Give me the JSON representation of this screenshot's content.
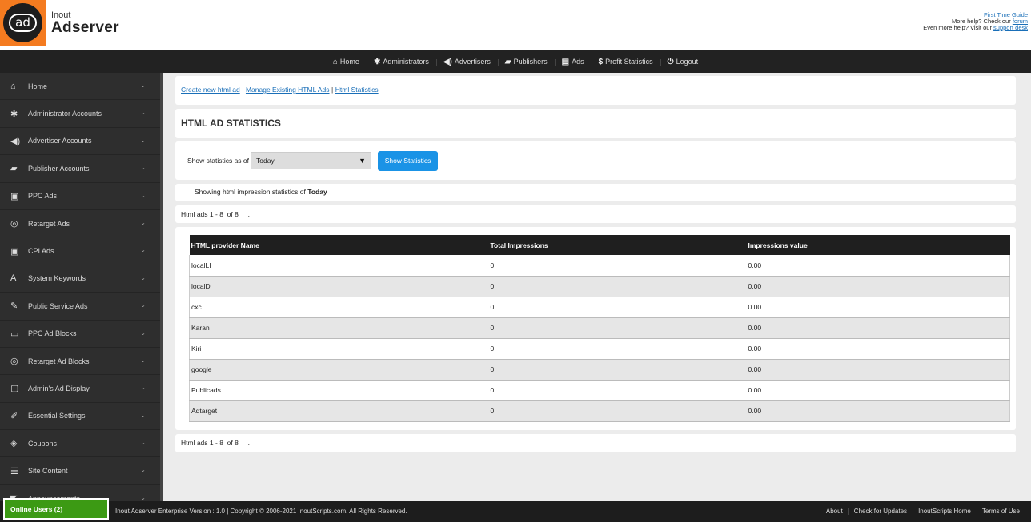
{
  "brand": {
    "small": "Inout",
    "big": "Adserver",
    "logo_text": "ad"
  },
  "help": {
    "first_time_guide": "First Time Guide",
    "more_help_prefix": "More help? Check our",
    "forum": "forum",
    "even_more_prefix": "Even more help? Visit our",
    "support_desk": "support desk"
  },
  "topnav": [
    {
      "label": "Home",
      "icon": "home-icon",
      "glyph": "⌂"
    },
    {
      "label": "Administrators",
      "icon": "gear-icon",
      "glyph": "✱"
    },
    {
      "label": "Advertisers",
      "icon": "speaker-icon",
      "glyph": "◀)"
    },
    {
      "label": "Publishers",
      "icon": "book-icon",
      "glyph": "▰"
    },
    {
      "label": "Ads",
      "icon": "document-icon",
      "glyph": "▤"
    },
    {
      "label": "Profit Statistics",
      "icon": "dollar-icon",
      "glyph": "$"
    },
    {
      "label": "Logout",
      "icon": "power-icon",
      "glyph": "⏻"
    }
  ],
  "sidebar": [
    {
      "label": "Home",
      "icon": "home-icon",
      "glyph": "⌂"
    },
    {
      "label": "Administrator Accounts",
      "icon": "gear-icon",
      "glyph": "✱"
    },
    {
      "label": "Advertiser Accounts",
      "icon": "speaker-icon",
      "glyph": "◀)"
    },
    {
      "label": "Publisher Accounts",
      "icon": "book-icon",
      "glyph": "▰"
    },
    {
      "label": "PPC Ads",
      "icon": "image-icon",
      "glyph": "▣"
    },
    {
      "label": "Retarget Ads",
      "icon": "target-icon",
      "glyph": "◎"
    },
    {
      "label": "CPI Ads",
      "icon": "image-icon",
      "glyph": "▣"
    },
    {
      "label": "System Keywords",
      "icon": "font-icon",
      "glyph": "A"
    },
    {
      "label": "Public Service Ads",
      "icon": "edit-icon",
      "glyph": "✎"
    },
    {
      "label": "PPC Ad Blocks",
      "icon": "monitor-icon",
      "glyph": "▭"
    },
    {
      "label": "Retarget Ad Blocks",
      "icon": "target-icon",
      "glyph": "◎"
    },
    {
      "label": "Admin's Ad Display",
      "icon": "code-file-icon",
      "glyph": "▢"
    },
    {
      "label": "Essential Settings",
      "icon": "wrench-icon",
      "glyph": "✐"
    },
    {
      "label": "Coupons",
      "icon": "tag-icon",
      "glyph": "◈"
    },
    {
      "label": "Site Content",
      "icon": "list-icon",
      "glyph": "☰"
    },
    {
      "label": "Announcements",
      "icon": "megaphone-icon",
      "glyph": "◤"
    }
  ],
  "actions": {
    "create": "Create new html ad",
    "manage": "Manage Existing HTML Ads",
    "stats": "Html Statistics",
    "sep": "|"
  },
  "page_title": "HTML AD STATISTICS",
  "filter": {
    "label": "Show statistics as of",
    "selected": "Today",
    "button": "Show Statistics"
  },
  "showing": {
    "prefix": "Showing html impression statistics of",
    "period": "Today"
  },
  "pagination": {
    "text": "Html ads",
    "range": "1 - 8",
    "of": "of 8",
    "dot": "."
  },
  "table": {
    "headers": [
      "HTML provider Name",
      "Total Impressions",
      "Impressions value"
    ],
    "rows": [
      [
        "localLI",
        "0",
        "0.00"
      ],
      [
        "localD",
        "0",
        "0.00"
      ],
      [
        "cxc",
        "0",
        "0.00"
      ],
      [
        "Karan",
        "0",
        "0.00"
      ],
      [
        "Kiri",
        "0",
        "0.00"
      ],
      [
        "google",
        "0",
        "0.00"
      ],
      [
        "Publicads",
        "0",
        "0.00"
      ],
      [
        "Adtarget",
        "0",
        "0.00"
      ]
    ]
  },
  "footer": {
    "online": "Online Users (2)",
    "copyright": "Inout Adserver Enterprise Version : 1.0 |  Copyright © 2006-2021 InoutScripts.com. All Rights Reserved.",
    "links": [
      "About",
      "Check for Updates",
      "InoutScripts Home",
      "Terms of Use"
    ]
  },
  "colors": {
    "accent": "#1a93e6",
    "brand_orange": "#f47b20",
    "online_green": "#3c9a14"
  }
}
